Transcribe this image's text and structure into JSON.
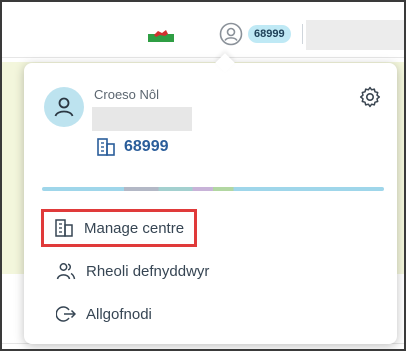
{
  "topbar": {
    "centre_pill": "68999"
  },
  "account_menu": {
    "welcome_text": "Croeso Nôl",
    "centre_number": "68999",
    "items": [
      {
        "label": "Manage centre",
        "icon": "building-icon"
      },
      {
        "label": "Rheoli defnyddwyr",
        "icon": "users-icon"
      },
      {
        "label": "Allgofnodi",
        "icon": "logout-icon"
      }
    ]
  },
  "colors": {
    "accent_blue": "#2a5d9a",
    "pill_bg": "#bfe9f5",
    "highlight_red": "#e03a3a",
    "avatar_bg": "#bde3ef"
  }
}
